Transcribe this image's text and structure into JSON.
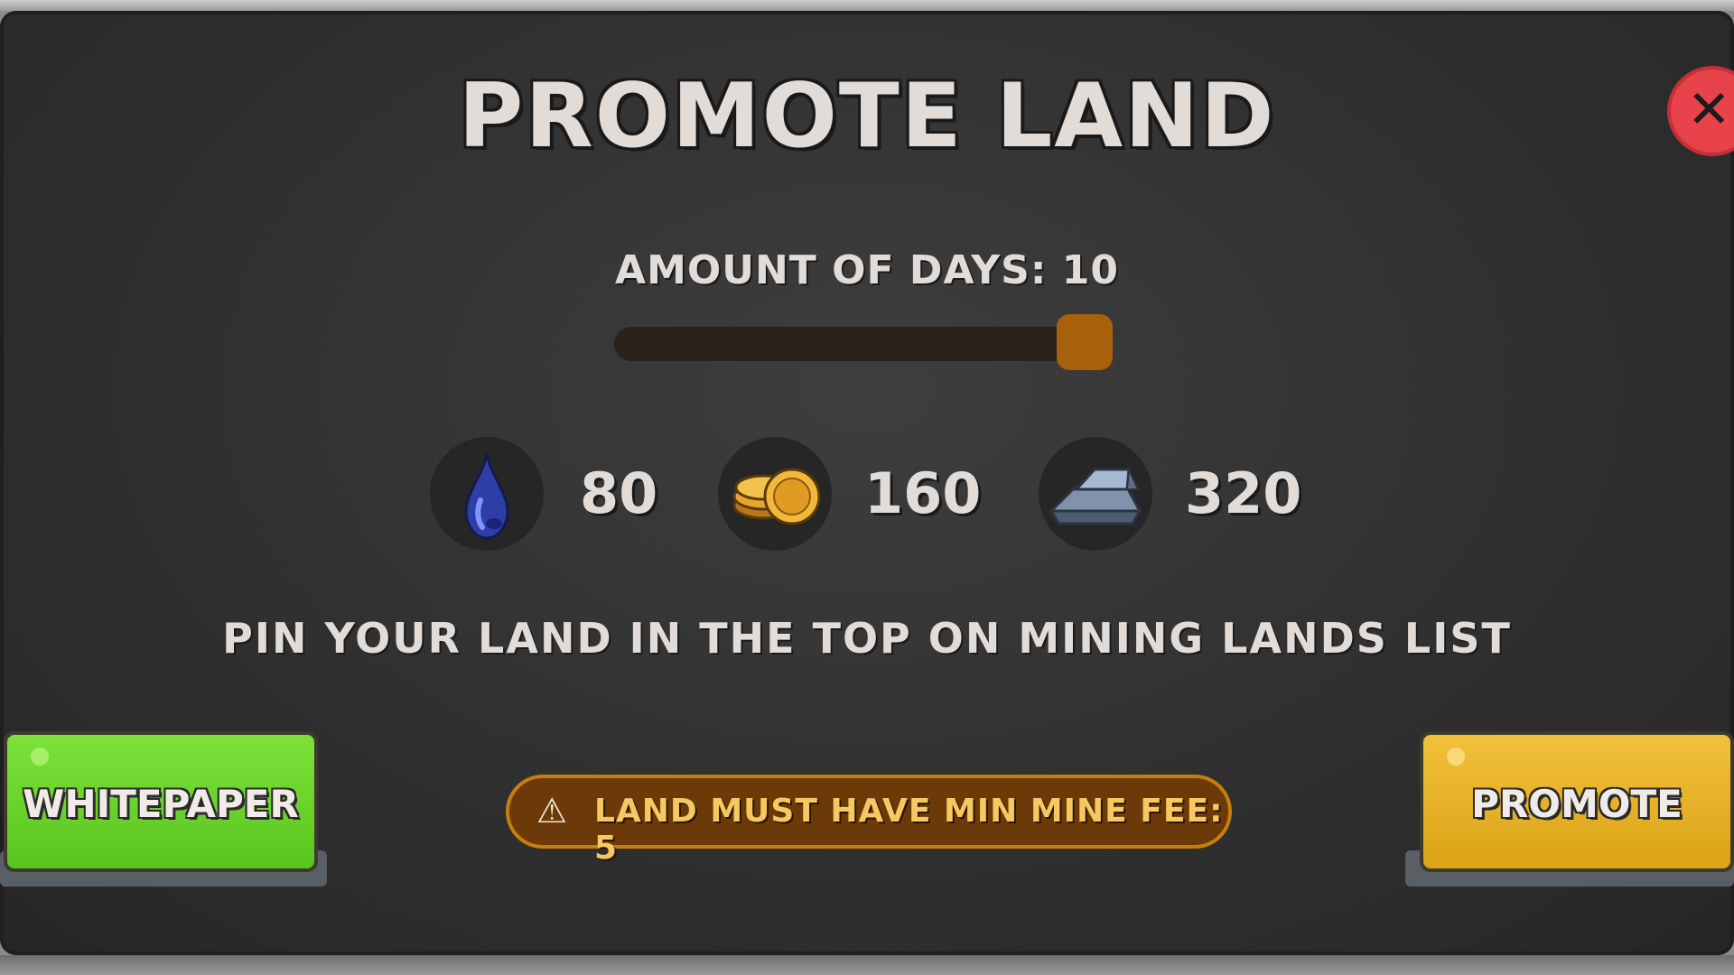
{
  "modal": {
    "title": "PROMOTE LAND",
    "close_icon": "close-icon"
  },
  "days": {
    "label": "AMOUNT OF DAYS: 10",
    "value": 10,
    "slider_fraction": 1.0
  },
  "costs": [
    {
      "icon": "oil-drop-icon",
      "value": "80"
    },
    {
      "icon": "gold-coins-icon",
      "value": "160"
    },
    {
      "icon": "metal-ingot-icon",
      "value": "320"
    }
  ],
  "hint": "PIN YOUR LAND IN THE TOP ON MINING LANDS LIST",
  "buttons": {
    "whitepaper": "WHITEPAPER",
    "promote": "PROMOTE"
  },
  "warning": {
    "icon": "warning-icon",
    "text": "LAND MUST HAVE MIN MINE FEE: 5"
  },
  "colors": {
    "slider_thumb": "#a7600c",
    "close_button": "#e8424a",
    "whitepaper_button": "#6fd42d",
    "promote_button": "#e9b426",
    "warning_border": "#c67f0c"
  }
}
